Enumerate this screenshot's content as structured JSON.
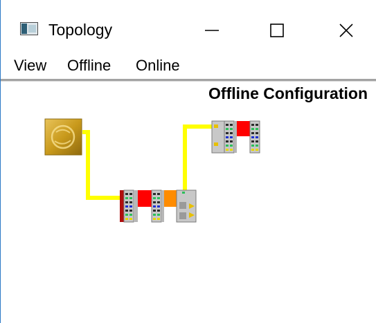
{
  "window": {
    "title": "Topology",
    "icon": "window-app-icon",
    "controls": [
      "minimize-icon",
      "maximize-icon",
      "close-icon"
    ]
  },
  "menu": {
    "items": [
      {
        "label": "View"
      },
      {
        "label": "Offline"
      },
      {
        "label": "Online"
      }
    ]
  },
  "canvas": {
    "title": "Offline Configuration",
    "colors": {
      "connection": "#ffff00",
      "master_gold": "#c99a1c",
      "module_red": "#ff0000",
      "module_orange": "#ff8c00",
      "module_gray": "#a9a9a9",
      "power_bar": "#b00d0d"
    },
    "nodes": [
      {
        "icon": "ethercat-master-icon"
      },
      {
        "icon": "coupler-terminal-block-icon"
      },
      {
        "icon": "remote-terminal-block-icon"
      }
    ]
  }
}
